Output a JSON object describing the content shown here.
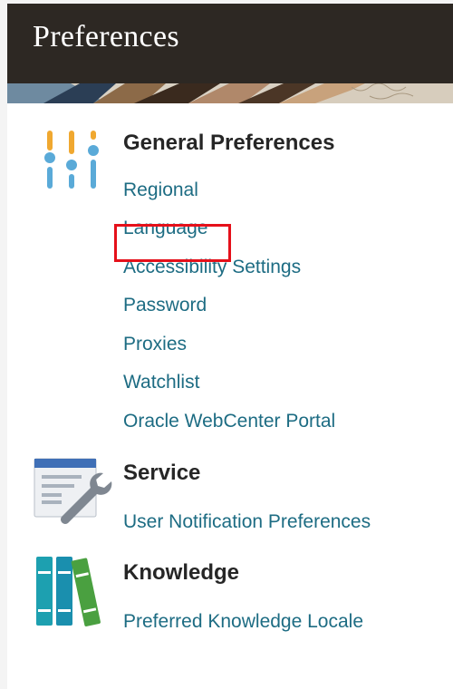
{
  "header": {
    "title": "Preferences"
  },
  "sections": [
    {
      "title": "General Preferences",
      "icon": "sliders-icon",
      "links": [
        "Regional",
        "Language",
        "Accessibility Settings",
        "Password",
        "Proxies",
        "Watchlist",
        "Oracle WebCenter Portal"
      ]
    },
    {
      "title": "Service",
      "icon": "service-wrench-icon",
      "links": [
        "User Notification Preferences"
      ]
    },
    {
      "title": "Knowledge",
      "icon": "books-icon",
      "links": [
        "Preferred Knowledge Locale"
      ]
    }
  ],
  "highlighted_link": "Language",
  "colors": {
    "header_bg": "#2d2823",
    "link": "#1d6c83",
    "highlight": "#e5101a",
    "sliders_orange": "#f0a830",
    "sliders_blue": "#5aaad8",
    "books_teal": "#1da0b0",
    "books_green": "#4aa040"
  }
}
